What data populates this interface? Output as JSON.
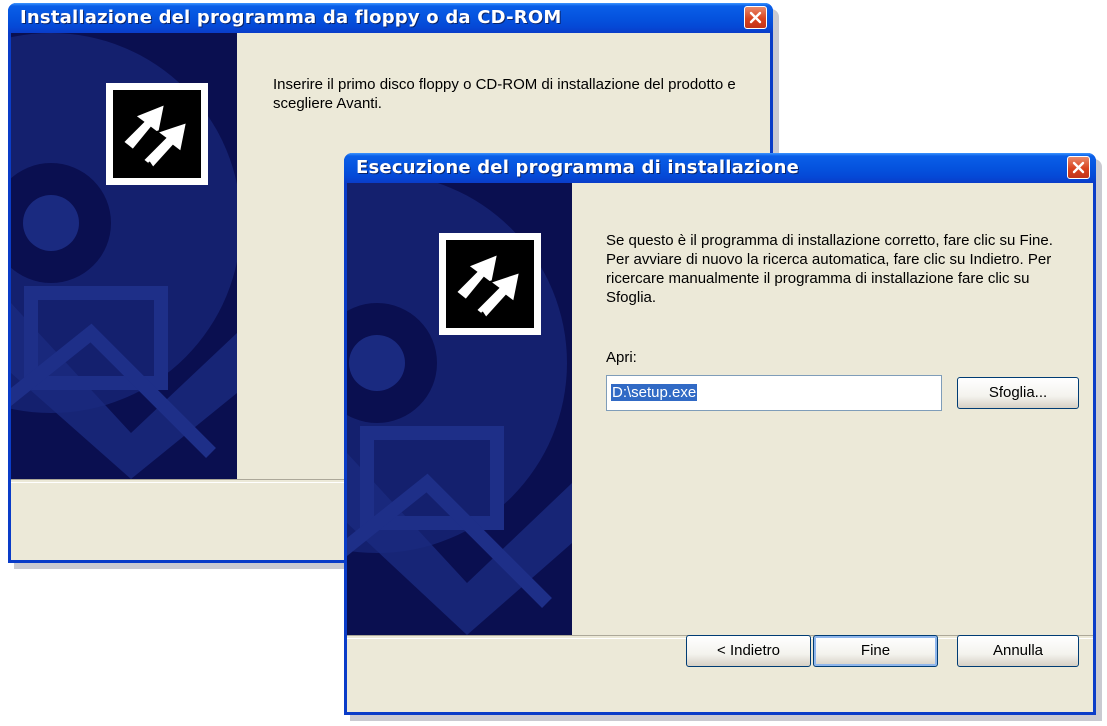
{
  "back_window": {
    "title": "Installazione del programma da floppy o da CD-ROM",
    "message": "Inserire il primo disco floppy o CD-ROM di installazione del prodotto e scegliere Avanti."
  },
  "front_window": {
    "title": "Esecuzione del programma di installazione",
    "message": "Se questo è il programma di installazione corretto, fare clic su Fine. Per avviare di nuovo la ricerca automatica, fare clic su Indietro. Per ricercare manualmente il programma di installazione fare clic su Sfoglia.",
    "open_label": "Apri:",
    "open_value": "D:\\setup.exe",
    "browse_label": "Sfoglia...",
    "back_label": "< Indietro",
    "finish_label": "Fine",
    "cancel_label": "Annulla"
  },
  "icons": [
    "close-icon",
    "install-arrows-icon",
    "cd-disc-icon"
  ],
  "colors": {
    "titlebar": "#0553de",
    "sidebar": "#0a0f50",
    "close": "#d9431f",
    "face": "#ece9d8"
  }
}
